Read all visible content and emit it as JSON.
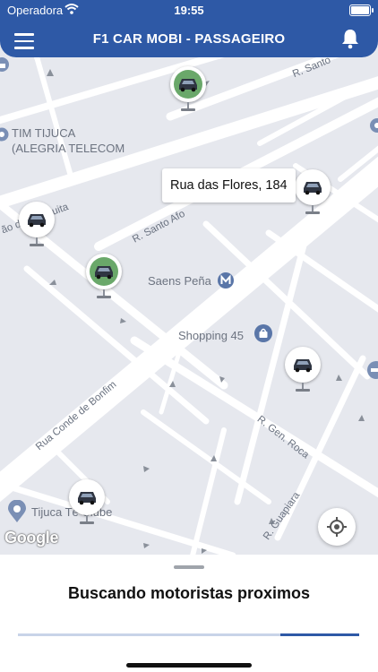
{
  "status_bar": {
    "carrier": "Operadora",
    "time": "19:55"
  },
  "header": {
    "title": "F1 CAR MOBI - PASSAGEIRO"
  },
  "map": {
    "address_tooltip": "Rua das Flores, 184",
    "places": {
      "tim": [
        "TIM TIJUCA",
        "(ALEGRIA TELECOM"
      ],
      "saens": "Saens Peña",
      "shopping": "Shopping 45",
      "tijuca_clube": "Tijuca Tê Clube"
    },
    "streets": {
      "santo_top": "R. Santo",
      "santo_mid": "R. Santo Afo",
      "mesquita": "ão de Mesquita",
      "conde": "Rua Conde de Bonfim",
      "gen_roca": "R. Gen. Roca",
      "guapiara": "R. Guapiara"
    },
    "attribution": "Google"
  },
  "sheet": {
    "message": "Buscando motoristas proximos",
    "progress_fraction": 0.23
  },
  "colors": {
    "brand": "#2e59a6",
    "active_car": "#6aa86a",
    "map_bg": "#e6e8ee"
  }
}
